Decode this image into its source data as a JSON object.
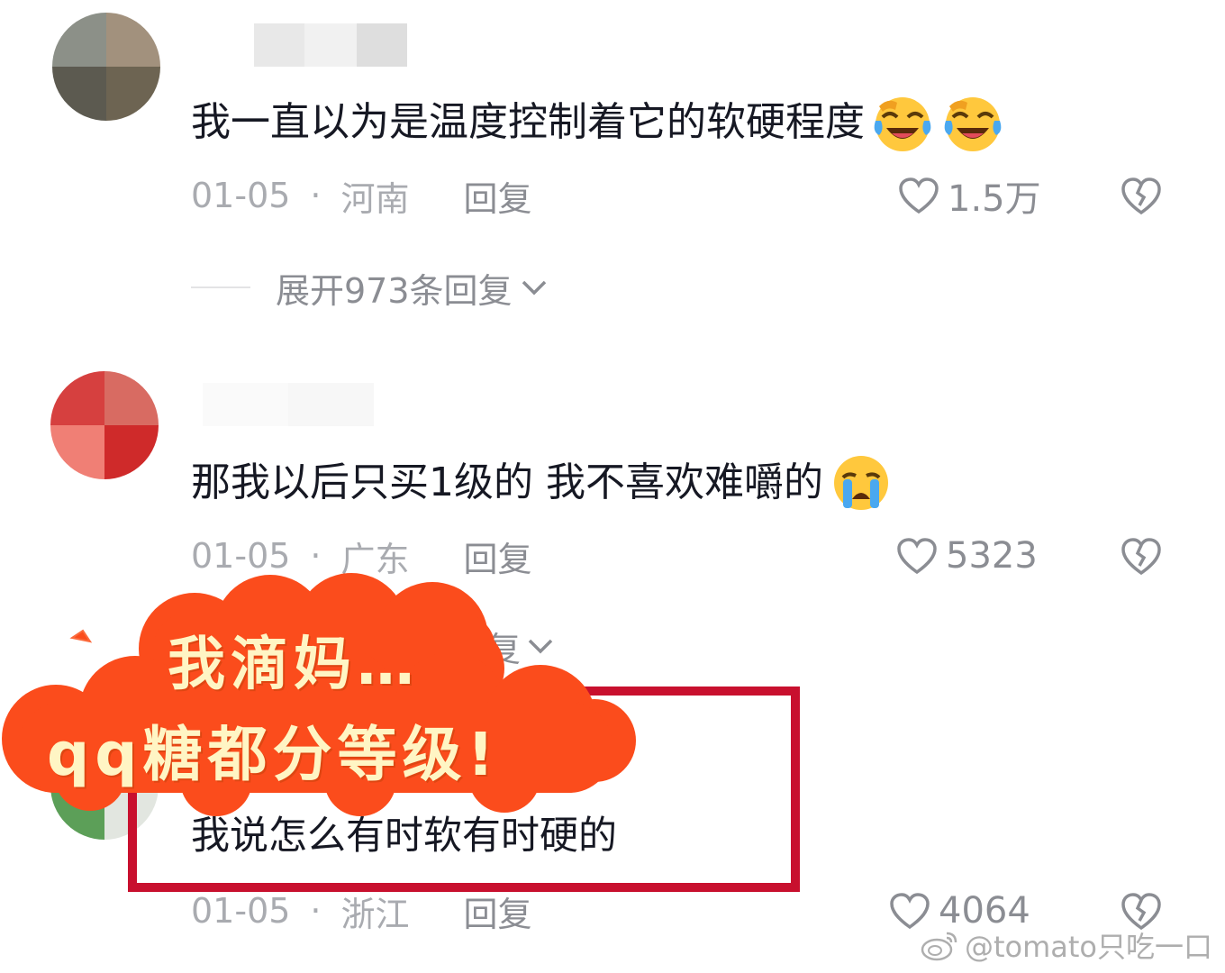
{
  "comments": [
    {
      "text": "我一直以为是温度控制着它的软硬程度",
      "emojis": [
        "laugh-cry-emoji",
        "laugh-cry-emoji"
      ],
      "date": "01-05",
      "location": "河南",
      "reply_label": "回复",
      "likes": "1.5万",
      "expand_label": "展开973条回复"
    },
    {
      "text": "那我以后只买1级的 我不喜欢难嚼的",
      "emojis": [
        "crying-emoji"
      ],
      "date": "01-05",
      "location": "广东",
      "reply_label": "回复",
      "likes": "5323",
      "expand_partial": "复"
    },
    {
      "text": "我说怎么有时软有时硬的",
      "date": "01-05",
      "location": "浙江",
      "reply_label": "回复",
      "likes": "4064"
    }
  ],
  "separator": "·",
  "sticker": {
    "line1": "我滴妈…",
    "line2": "qq糖都分等级!",
    "bg_color": "#fb4c1c",
    "text_color": "#fff5c4"
  },
  "highlight_color": "#c8102e",
  "watermark": "@tomato只吃一口",
  "icons": [
    "heart-icon",
    "broken-heart-icon",
    "chevron-down-icon",
    "weibo-icon"
  ]
}
